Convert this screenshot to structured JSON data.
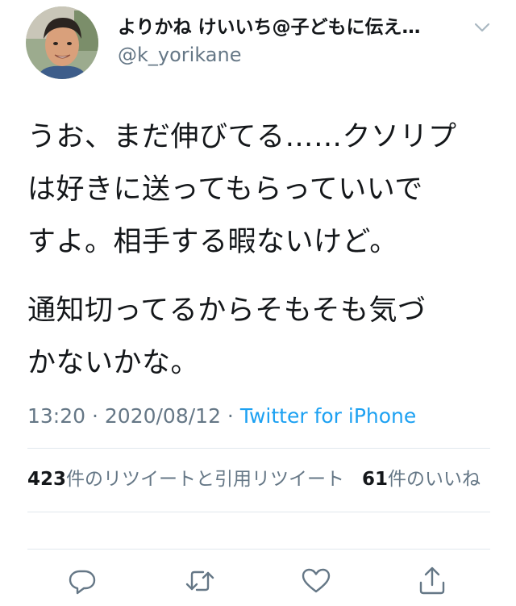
{
  "tweet": {
    "display_name": "よりかね けいいち@子どもに伝え…",
    "handle": "@k_yorikane",
    "text_paragraph_1": "うお、まだ伸びてる……クソリプ\nは好きに送ってもらっていいで\nすよ。相手する暇ないけど。",
    "text_paragraph_2": "通知切ってるからそもそも気づ\nかないかな。",
    "time": "13:20",
    "separator": " · ",
    "date": "2020/08/12",
    "source": "Twitter for iPhone"
  },
  "stats": {
    "retweet_count": "423",
    "retweet_label": "件のリツイートと引用リツイート",
    "like_count": "61",
    "like_label": "件のいいね"
  },
  "icons": {
    "caret": "chevron-down-icon",
    "reply": "reply-icon",
    "retweet": "retweet-icon",
    "like": "heart-icon",
    "share": "share-icon"
  },
  "colors": {
    "text": "#14171a",
    "secondary": "#657786",
    "link": "#1da1f2",
    "divider": "#e1e8ed"
  }
}
